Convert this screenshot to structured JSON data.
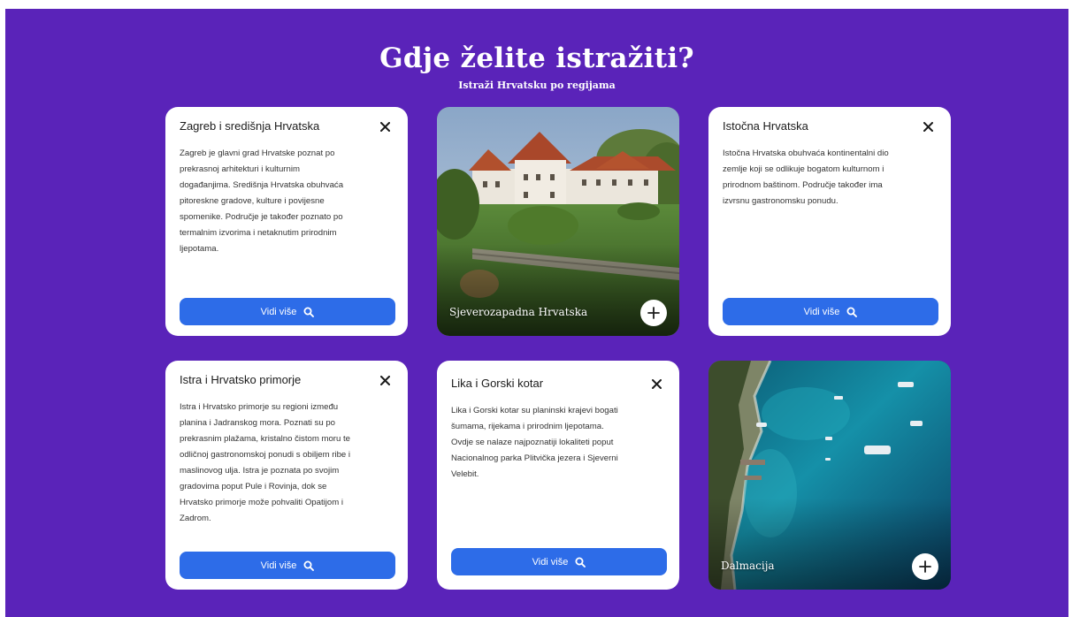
{
  "hero": {
    "title": "Gdje želite istražiti?",
    "subtitle": "Istraži Hrvatsku po regijama"
  },
  "regions": {
    "zagreb": {
      "title": "Zagreb i središnja Hrvatska",
      "lines": [
        "Zagreb je glavni grad Hrvatske poznat po",
        "prekrasnoj arhitekturi i kulturnim",
        "događanjima. Središnja Hrvatska obuhvaća",
        "pitoreskne gradove, kulture i povijesne",
        "spomenike. Područje je također poznato po",
        "termalnim izvorima i netaknutim prirodnim",
        "ljepotama."
      ],
      "button": "Vidi više"
    },
    "sjeverozapadna": {
      "title": "Sjeverozapadna Hrvatska"
    },
    "istocna": {
      "title": "Istočna Hrvatska",
      "lines": [
        "Istočna Hrvatska obuhvaća kontinentalni dio",
        "zemlje koji se odlikuje bogatom kulturnom i",
        "prirodnom baštinom. Područje također ima",
        "izvrsnu gastronomsku ponudu."
      ],
      "button": "Vidi više"
    },
    "istra": {
      "title": "Istra i Hrvatsko primorje",
      "lines": [
        "Istra i Hrvatsko primorje su regioni između",
        "planina i Jadranskog mora. Poznati su po",
        "prekrasnim plažama, kristalno čistom moru te",
        "odličnoj gastronomskoj ponudi s obiljem ribe i",
        "maslinovog ulja. Istra je poznata po svojim",
        "gradovima poput Pule i Rovinja, dok se",
        "Hrvatsko primorje može pohvaliti Opatijom i",
        "Zadrom."
      ],
      "button": "Vidi više"
    },
    "lika": {
      "title": "Lika i Gorski kotar",
      "lines": [
        "Lika i Gorski kotar su planinski krajevi bogati",
        "šumama, rijekama i prirodnim ljepotama.",
        "Ovdje se nalaze najpoznatiji lokaliteti poput",
        "Nacionalnog parka Plitvička jezera i Sjeverni",
        "Velebit."
      ],
      "button": "Vidi više"
    },
    "dalmacija": {
      "title": "Dalmacija"
    }
  },
  "icons": {
    "close": "close-icon",
    "search": "search-icon",
    "plus": "plus-icon"
  },
  "colors": {
    "background": "#5a23b9",
    "button": "#2d6ce8",
    "card": "#ffffff"
  }
}
